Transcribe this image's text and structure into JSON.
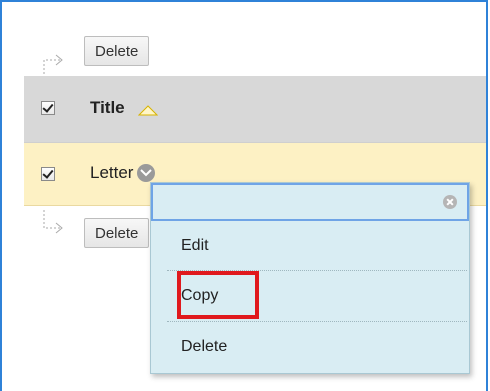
{
  "toolbar": {
    "delete_label": "Delete"
  },
  "table": {
    "header": {
      "title": "Title",
      "checked": true
    },
    "rows": [
      {
        "label": "Letter",
        "checked": true
      }
    ]
  },
  "context_menu": {
    "items": [
      "Edit",
      "Copy",
      "Delete"
    ],
    "highlighted_item": "Copy"
  },
  "colors": {
    "frame": "#2f82d8",
    "header_bg": "#d8d8d8",
    "row_highlight": "#fdf1c4",
    "menu_bg": "#d9edf3",
    "highlight_box": "#e0191d"
  },
  "icons": [
    "tree-arrow-icon",
    "sort-ascending-icon",
    "chevron-down-icon",
    "close-icon"
  ]
}
